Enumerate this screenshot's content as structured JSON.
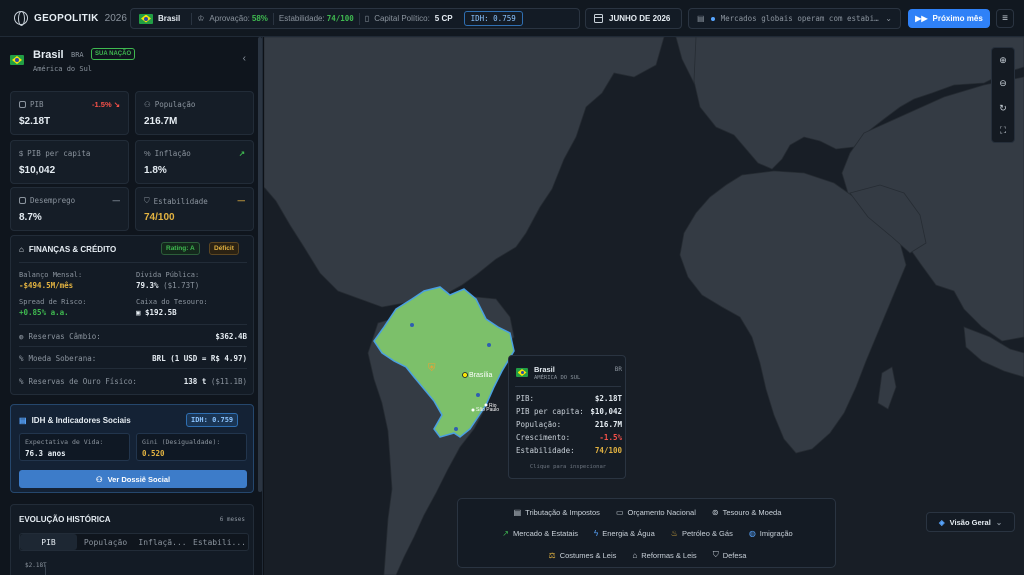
{
  "topbar": {
    "brand": "GEOPOLITIK",
    "year": "2026",
    "country": "Brasil",
    "approval_label": "Aprovação:",
    "approval_value": "58%",
    "stability_label": "Estabilidade:",
    "stability_value": "74/100",
    "capital_label": "Capital Político:",
    "capital_value": "5 CP",
    "idh_chip": "IDH: 0.759",
    "date": "JUNHO DE 2026",
    "news": "Mercados globais operam com estabilidade",
    "next_button": "Próximo mês"
  },
  "country": {
    "name": "Brasil",
    "code": "BRA",
    "badge": "SUA NAÇÃO",
    "region": "América do Sul"
  },
  "stats": [
    {
      "label": "PIB",
      "value": "$2.18T",
      "trend": "-1.5% ↘"
    },
    {
      "label": "População",
      "value": "216.7M",
      "trend": ""
    },
    {
      "label": "PIB per capita",
      "value": "$10,042",
      "trend": ""
    },
    {
      "label": "Inflação",
      "value": "1.8%",
      "trend": "↗"
    },
    {
      "label": "Desemprego",
      "value": "8.7%",
      "trend": "—"
    },
    {
      "label": "Estabilidade",
      "value": "74/100",
      "trend": "—"
    }
  ],
  "finance": {
    "title": "FINANÇAS & CRÉDITO",
    "rating": "Rating: A",
    "deficit": "Déficit",
    "monthly_balance_label": "Balanço Mensal:",
    "monthly_balance_value": "-$494.5M/mês",
    "public_debt_label": "Dívida Pública:",
    "public_debt_value": "79.3%",
    "public_debt_sub": "($1.73T)",
    "risk_spread_label": "Spread de Risco:",
    "risk_spread_value": "+0.85% a.a.",
    "treasury_label": "Caixa do Tesouro:",
    "treasury_value": "$192.5B",
    "fx_reserves_label": "Reservas Câmbio:",
    "fx_reserves_value": "$362.4B",
    "currency_label": "Moeda Soberana:",
    "currency_value": "BRL (1 USD = R$ 4.97)",
    "gold_label": "Reservas de Ouro Físico:",
    "gold_value": "138 t",
    "gold_sub": "($11.1B)"
  },
  "social": {
    "title": "IDH & Indicadores Sociais",
    "idh_chip": "IDH: 0.759",
    "life_label": "Expectativa de Vida:",
    "life_value": "76.3 anos",
    "gini_label": "Gini (Desigualdade):",
    "gini_value": "0.520",
    "button": "Ver Dossiê Social"
  },
  "history": {
    "title": "EVOLUÇÃO HISTÓRICA",
    "meta": "6 meses",
    "tabs": [
      "PIB",
      "População",
      "Inflação",
      "Estabilidade"
    ],
    "tabs_shown": [
      "PIB",
      "População",
      "Inflaçã...",
      "Estabili..."
    ],
    "y_first": "$2.18T"
  },
  "map": {
    "cities": [
      "Brasília",
      "Rio de Janeiro",
      "São Paulo"
    ],
    "city_labels_shown": [
      "Brasília",
      "Rio",
      "São Paulo"
    ]
  },
  "tooltip": {
    "name": "Brasil",
    "region": "AMÉRICA DO SUL",
    "code": "BR",
    "rows": [
      {
        "k": "PIB:",
        "v": "$2.18T"
      },
      {
        "k": "PIB per capita:",
        "v": "$10,042"
      },
      {
        "k": "População:",
        "v": "216.7M"
      },
      {
        "k": "Crescimento:",
        "v": "-1.5%"
      },
      {
        "k": "Estabilidade:",
        "v": "74/100"
      }
    ],
    "hint": "Clique para inspecionar"
  },
  "actions": {
    "row1": [
      "Tributação & Impostos",
      "Orçamento Nacional",
      "Tesouro & Moeda"
    ],
    "row2": [
      "Mercado & Estatais",
      "Energia & Água",
      "Petróleo & Gás",
      "Imigração"
    ],
    "row3": [
      "Costumes & Leis",
      "Reformas & Leis",
      "Defesa"
    ]
  },
  "view_button": "Visão Geral",
  "colors": {
    "accent": "#2f81f7",
    "positive": "#3fb950",
    "negative": "#f85149",
    "warning": "#e3b341",
    "brazil_fill": "#7cc06a"
  }
}
